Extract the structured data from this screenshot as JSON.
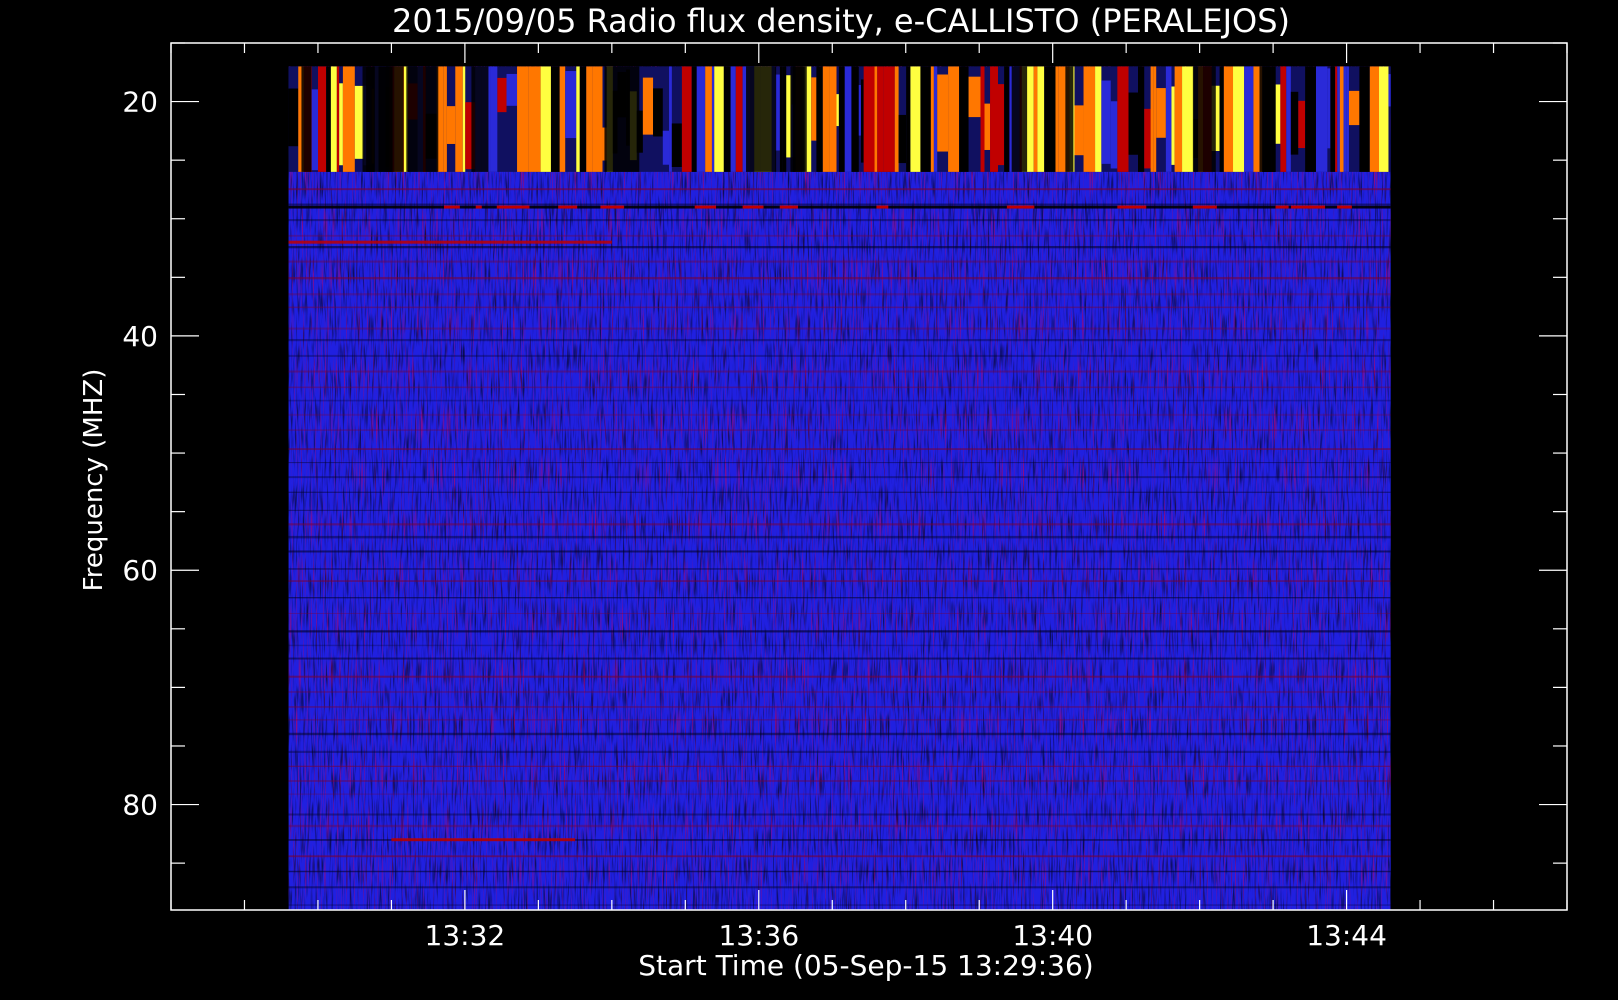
{
  "chart_data": {
    "type": "heatmap",
    "title": "2015/09/05  Radio flux density, e-CALLISTO (PERALEJOS)",
    "xlabel": "Start Time (05-Sep-15 13:29:36)",
    "ylabel": "Frequency (MHZ)",
    "x_unit": "time (HH:MM)",
    "xlim": [
      "13:28:00",
      "13:47:00"
    ],
    "ylim": [
      89,
      15
    ],
    "data_time_range": [
      "13:29:36",
      "13:44:36"
    ],
    "data_freq_range": [
      17,
      89
    ],
    "x_ticks": [
      "13:32",
      "13:36",
      "13:40",
      "13:44"
    ],
    "y_ticks": [
      20,
      40,
      60,
      80
    ],
    "colormap": "black-blue-red-yellow (red temperature)",
    "background_level": "blue",
    "features": [
      {
        "description": "strong bursty interference band",
        "freq_range": [
          17,
          26
        ],
        "colors": "red/orange/yellow with black gaps"
      },
      {
        "description": "narrow bright line",
        "freq": 29
      },
      {
        "description": "red streaks",
        "freq": 32,
        "time_range": [
          "13:29:36",
          "13:34:00"
        ]
      },
      {
        "description": "red streaks",
        "freq": 83,
        "time_range": [
          "13:31:00",
          "13:33:30"
        ]
      }
    ],
    "grid": false,
    "legend": "none"
  },
  "colors": {
    "background": "#000000",
    "foreground": "#ffffff",
    "spectrogram_base": "#2020e0",
    "hot_low": "#c00000",
    "hot_mid": "#ff7700",
    "hot_high": "#ffff40"
  }
}
